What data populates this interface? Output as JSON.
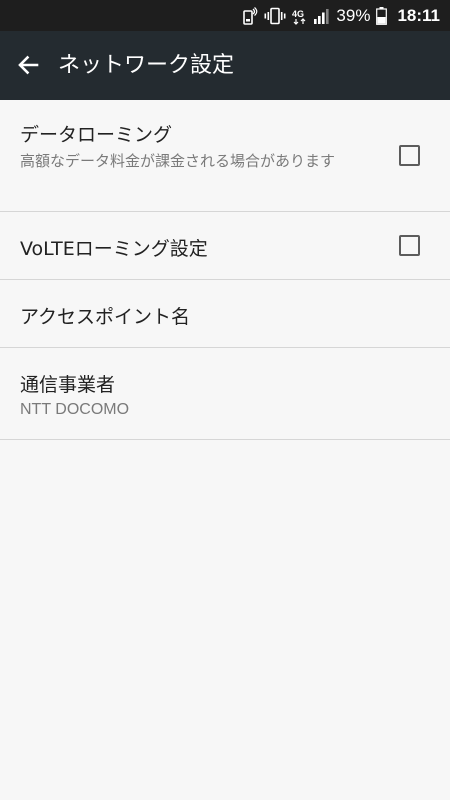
{
  "status_bar": {
    "battery_percent": "39%",
    "time": "18:11",
    "network_type": "4G"
  },
  "app_bar": {
    "title": "ネットワーク設定"
  },
  "settings": [
    {
      "title": "データローミング",
      "subtitle": "高額なデータ料金が課金される場合があります",
      "checked": false
    },
    {
      "title": "VoLTEローミング設定",
      "checked": false
    },
    {
      "title": "アクセスポイント名"
    },
    {
      "title": "通信事業者",
      "subtitle": "NTT DOCOMO"
    }
  ]
}
